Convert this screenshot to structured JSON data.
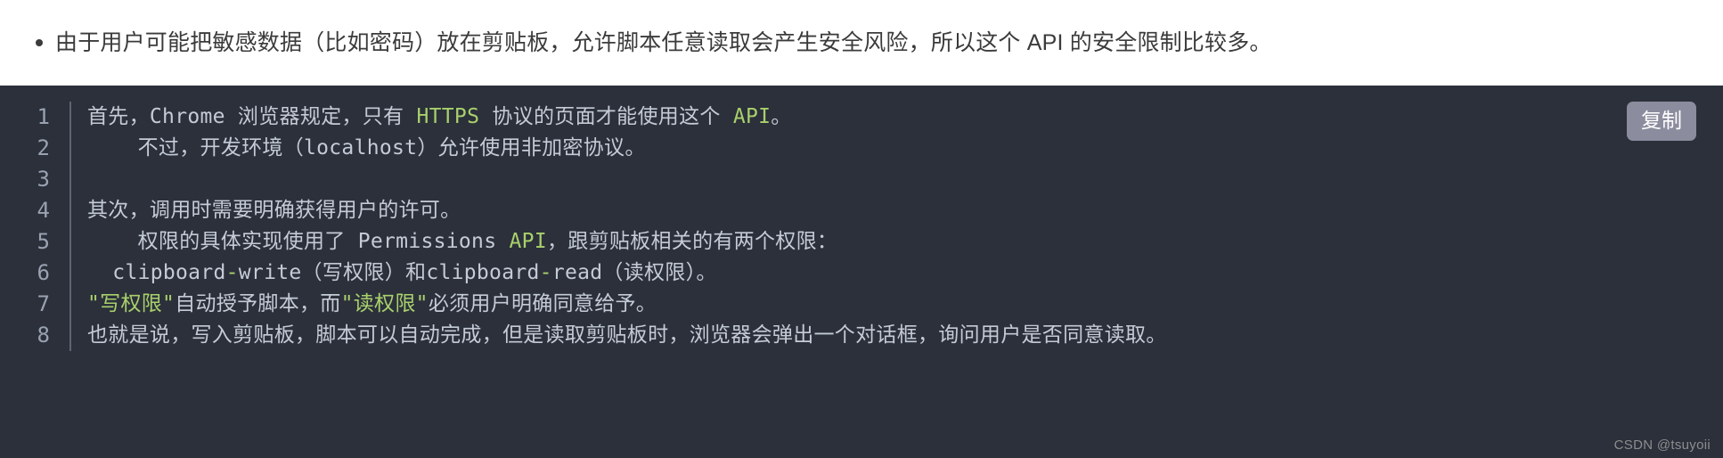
{
  "paragraph": {
    "bullet_text": "由于用户可能把敏感数据（比如密码）放在剪贴板，允许脚本任意读取会产生安全风险，所以这个 API 的安全限制比较多。"
  },
  "code_block": {
    "copy_label": "复制",
    "background_color": "#2b303b",
    "text_color": "#c5cbd6",
    "highlight_color": "#a9d06b",
    "line_number_color": "#9aa2b1",
    "lines": [
      {
        "number": "1",
        "tokens": [
          {
            "t": "首先，Chrome 浏览器规定，只有 ",
            "c": "plain"
          },
          {
            "t": "HTTPS",
            "c": "green"
          },
          {
            "t": " 协议的页面才能使用这个 ",
            "c": "plain"
          },
          {
            "t": "API",
            "c": "green"
          },
          {
            "t": "。",
            "c": "plain"
          }
        ]
      },
      {
        "number": "2",
        "tokens": [
          {
            "t": "    不过，开发环境（localhost）允许使用非加密协议。",
            "c": "plain"
          }
        ]
      },
      {
        "number": "3",
        "tokens": []
      },
      {
        "number": "4",
        "tokens": [
          {
            "t": "其次，调用时需要明确获得用户的许可。",
            "c": "plain"
          }
        ]
      },
      {
        "number": "5",
        "tokens": [
          {
            "t": "    权限的具体实现使用了 Permissions ",
            "c": "plain"
          },
          {
            "t": "API",
            "c": "green"
          },
          {
            "t": "，跟剪贴板相关的有两个权限：",
            "c": "plain"
          }
        ]
      },
      {
        "number": "6",
        "tokens": [
          {
            "t": "  clipboard",
            "c": "plain"
          },
          {
            "t": "-",
            "c": "green"
          },
          {
            "t": "write（写权限）和clipboard",
            "c": "plain"
          },
          {
            "t": "-",
            "c": "green"
          },
          {
            "t": "read（读权限）。",
            "c": "plain"
          }
        ]
      },
      {
        "number": "7",
        "tokens": [
          {
            "t": "\"写权限\"",
            "c": "green"
          },
          {
            "t": "自动授予脚本，而",
            "c": "plain"
          },
          {
            "t": "\"读权限\"",
            "c": "green"
          },
          {
            "t": "必须用户明确同意给予。",
            "c": "plain"
          }
        ]
      },
      {
        "number": "8",
        "tokens": [
          {
            "t": "也就是说，写入剪贴板，脚本可以自动完成，但是读取剪贴板时，浏览器会弹出一个对话框，询问用户是否同意读取。",
            "c": "plain"
          }
        ]
      }
    ]
  },
  "watermark": {
    "text": "CSDN @tsuyoii"
  }
}
